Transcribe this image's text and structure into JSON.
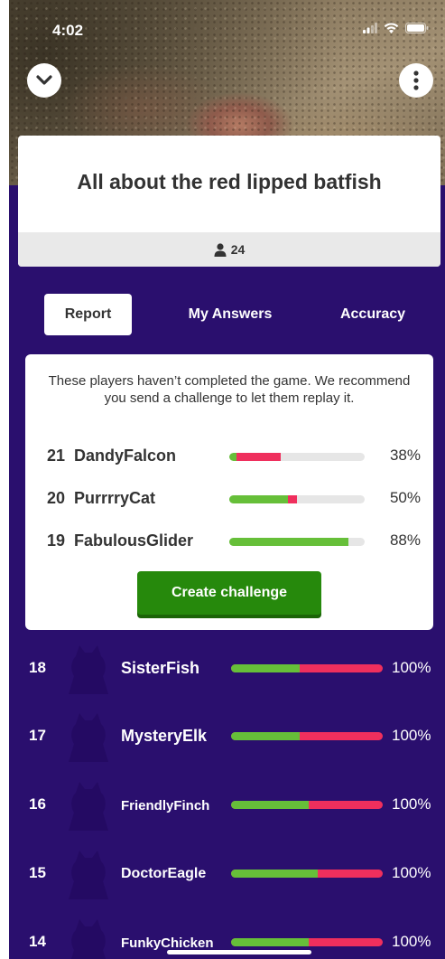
{
  "status": {
    "time": "4:02"
  },
  "quiz": {
    "title": "All about the red lipped batfish",
    "players": "24"
  },
  "tabs": [
    "Report",
    "My Answers",
    "Accuracy"
  ],
  "report": {
    "message": "These players haven’t completed the game. We recommend you send a challenge to let them replay it.",
    "incomplete": [
      {
        "rank": "21",
        "name": "DandyFalcon",
        "pct": "38%",
        "correct": 0.05,
        "incorrect": 0.33
      },
      {
        "rank": "20",
        "name": "PurrrryCat",
        "pct": "50%",
        "correct": 0.43,
        "incorrect": 0.07
      },
      {
        "rank": "19",
        "name": "FabulousGlider",
        "pct": "88%",
        "correct": 0.88,
        "incorrect": 0.0
      }
    ],
    "button_label": "Create challenge"
  },
  "leaderboard": [
    {
      "rank": "18",
      "name": "SisterFish",
      "pct": "100%",
      "correct": 0.45
    },
    {
      "rank": "17",
      "name": "MysteryElk",
      "pct": "100%",
      "correct": 0.45
    },
    {
      "rank": "16",
      "name": "FriendlyFinch",
      "pct": "100%",
      "correct": 0.51
    },
    {
      "rank": "15",
      "name": "DoctorEagle",
      "pct": "100%",
      "correct": 0.57
    },
    {
      "rank": "14",
      "name": "FunkyChicken",
      "pct": "100%",
      "correct": 0.51
    }
  ],
  "colors": {
    "background": "#2a0f6e",
    "correct": "#66bf39",
    "incorrect": "#ef2f5d",
    "button": "#26890c",
    "avatar": "#240a63"
  },
  "icons": {
    "collapse": "chevron-down-icon",
    "more": "more-vertical-icon",
    "players": "person-icon"
  }
}
